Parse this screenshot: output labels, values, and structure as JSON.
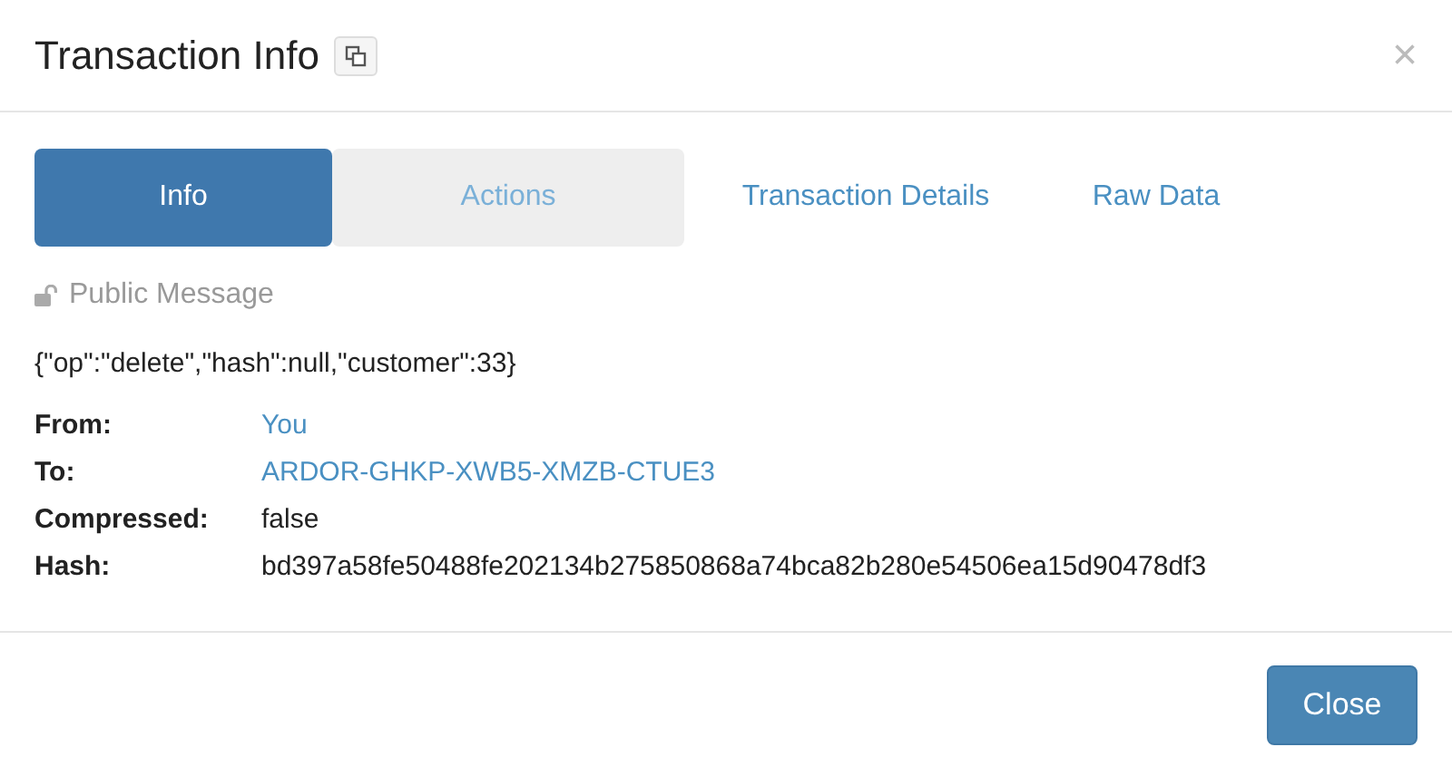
{
  "dialog": {
    "title": "Transaction Info",
    "close": "×"
  },
  "tabs": [
    {
      "label": "Info",
      "selected": true,
      "hovered": false
    },
    {
      "label": "Actions",
      "selected": false,
      "hovered": true
    },
    {
      "label": "Transaction Details",
      "selected": false,
      "hovered": false
    },
    {
      "label": "Raw Data",
      "selected": false,
      "hovered": false
    }
  ],
  "message": {
    "label": "Public Message",
    "body": "{\"op\":\"delete\",\"hash\":null,\"customer\":33}"
  },
  "fields": [
    {
      "label": "From:",
      "value": "You",
      "kind": "link"
    },
    {
      "label": "To:",
      "value": "ARDOR-GHKP-XWB5-XMZB-CTUE3",
      "kind": "link"
    },
    {
      "label": "Compressed:",
      "value": "false",
      "kind": "text"
    },
    {
      "label": "Hash:",
      "value": "bd397a58fe50488fe202134b275850868a74bca82b280e54506ea15d90478df3",
      "kind": "text"
    }
  ],
  "buttons": [
    "Close"
  ]
}
